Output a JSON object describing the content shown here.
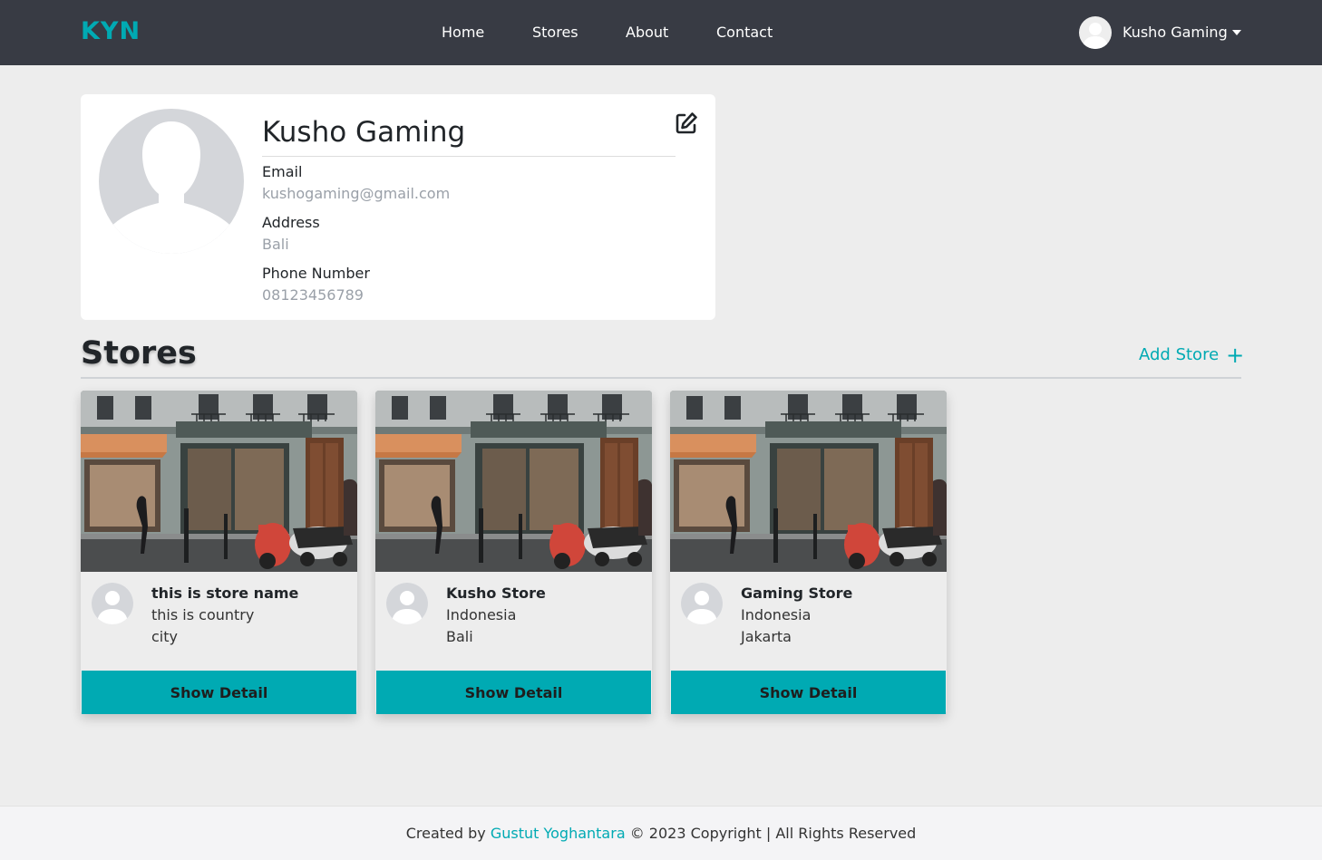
{
  "nav": {
    "brand": "KYN",
    "links": [
      "Home",
      "Stores",
      "About",
      "Contact"
    ],
    "user_name": "Kusho Gaming"
  },
  "profile": {
    "name": "Kusho Gaming",
    "email_label": "Email",
    "email": "kushogaming@gmail.com",
    "address_label": "Address",
    "address": "Bali",
    "phone_label": "Phone Number",
    "phone": "08123456789"
  },
  "stores": {
    "title": "Stores",
    "add_label": "Add Store",
    "add_icon": "+",
    "items": [
      {
        "name": "this is store name",
        "country": "this is country",
        "city": "city",
        "button": "Show Detail"
      },
      {
        "name": "Kusho Store",
        "country": "Indonesia",
        "city": "Bali",
        "button": "Show Detail"
      },
      {
        "name": "Gaming Store",
        "country": "Indonesia",
        "city": "Jakarta",
        "button": "Show Detail"
      }
    ]
  },
  "footer": {
    "prefix": "Created by",
    "author": "Gustut Yoghantara",
    "suffix": "© 2023 Copyright | All Rights Reserved"
  },
  "colors": {
    "accent": "#00aab3",
    "navbar": "#383b44",
    "background": "#ededed"
  },
  "icons": {
    "edit": "edit-icon",
    "avatar": "user-silhouette-icon",
    "dropdown": "caret-down-icon",
    "add": "plus-icon"
  }
}
